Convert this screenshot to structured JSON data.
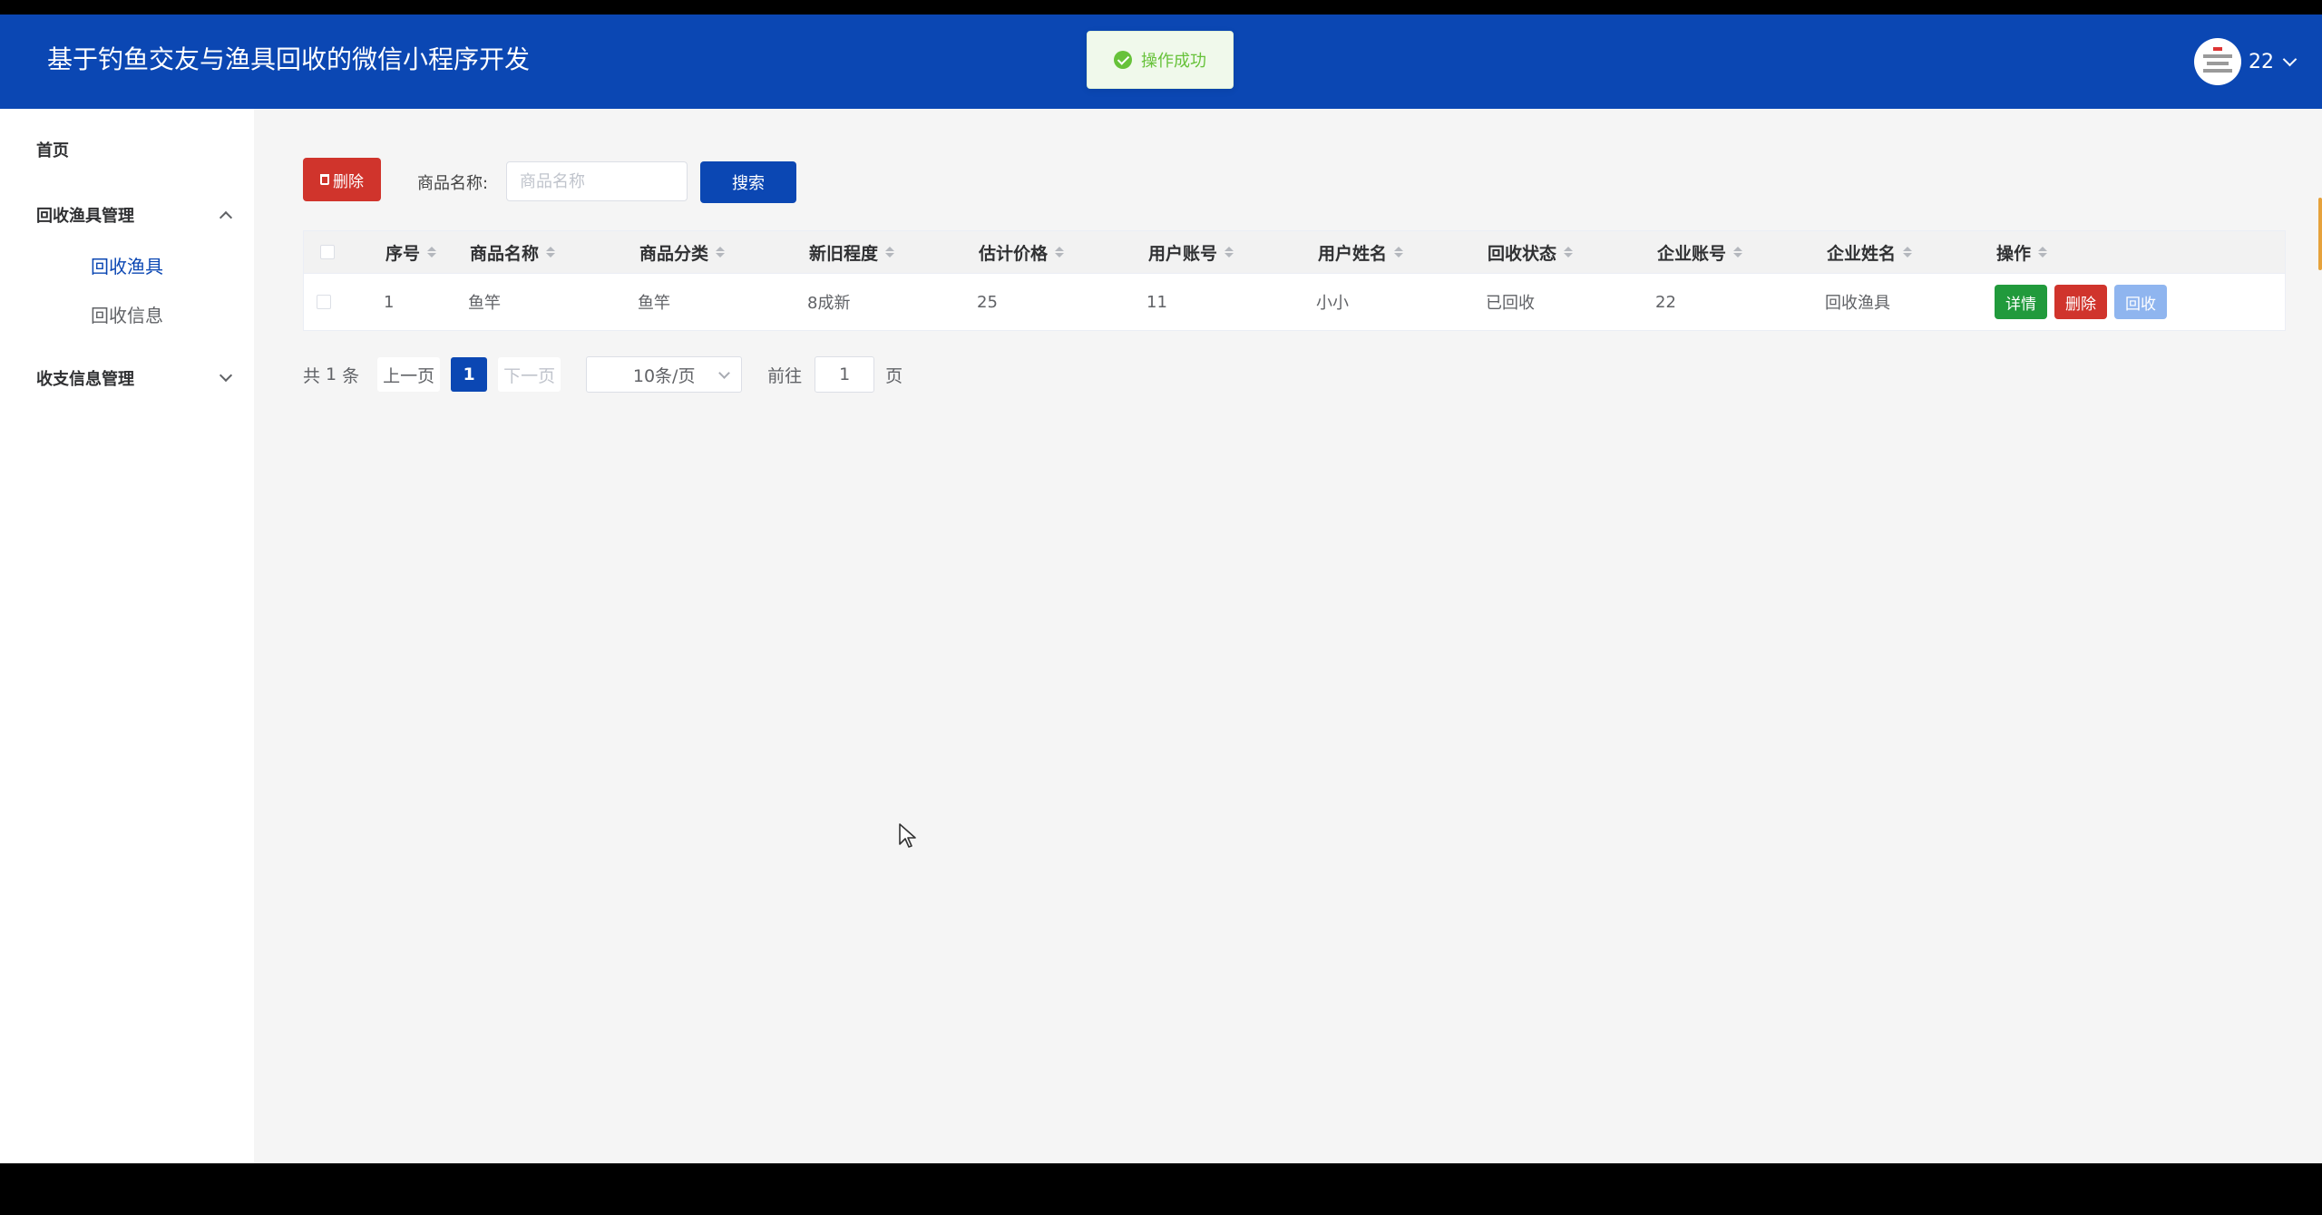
{
  "header": {
    "app_title": "基于钓鱼交友与渔具回收的微信小程序开发",
    "user_name": "22",
    "avatar_icon": "user-avatar",
    "dropdown_icon": "chevron-down-icon"
  },
  "toast": {
    "message": "操作成功",
    "icon": "check-circle-icon",
    "color": "#67c23a"
  },
  "sidebar": {
    "home": "首页",
    "group1": {
      "label": "回收渔具管理",
      "expanded": true,
      "items": [
        "回收渔具",
        "回收信息"
      ],
      "active_index": 0
    },
    "group2": {
      "label": "收支信息管理",
      "expanded": false
    }
  },
  "toolbar": {
    "delete_label": "删除",
    "search_label": "商品名称:",
    "search_placeholder": "商品名称",
    "search_button": "搜索"
  },
  "table": {
    "columns": [
      "序号",
      "商品名称",
      "商品分类",
      "新旧程度",
      "估计价格",
      "用户账号",
      "用户姓名",
      "回收状态",
      "企业账号",
      "企业姓名",
      "操作"
    ],
    "rows": [
      {
        "index": "1",
        "name": "鱼竿",
        "category": "鱼竿",
        "condition": "8成新",
        "price": "25",
        "user_account": "11",
        "user_name": "小小",
        "status": "已回收",
        "company_account": "22",
        "company_name": "回收渔具"
      }
    ],
    "row_actions": {
      "detail": "详情",
      "delete": "删除",
      "recycle": "回收"
    }
  },
  "pagination": {
    "total_prefix": "共",
    "total": "1",
    "total_suffix": "条",
    "prev": "上一页",
    "current": "1",
    "next": "下一页",
    "page_size": "10条/页",
    "goto_label": "前往",
    "goto_value": "1",
    "page_unit": "页"
  },
  "colors": {
    "brand": "#0b47b3",
    "danger": "#d0342c",
    "success": "#219a3c",
    "recycle_disabled": "#8fb5ef"
  }
}
